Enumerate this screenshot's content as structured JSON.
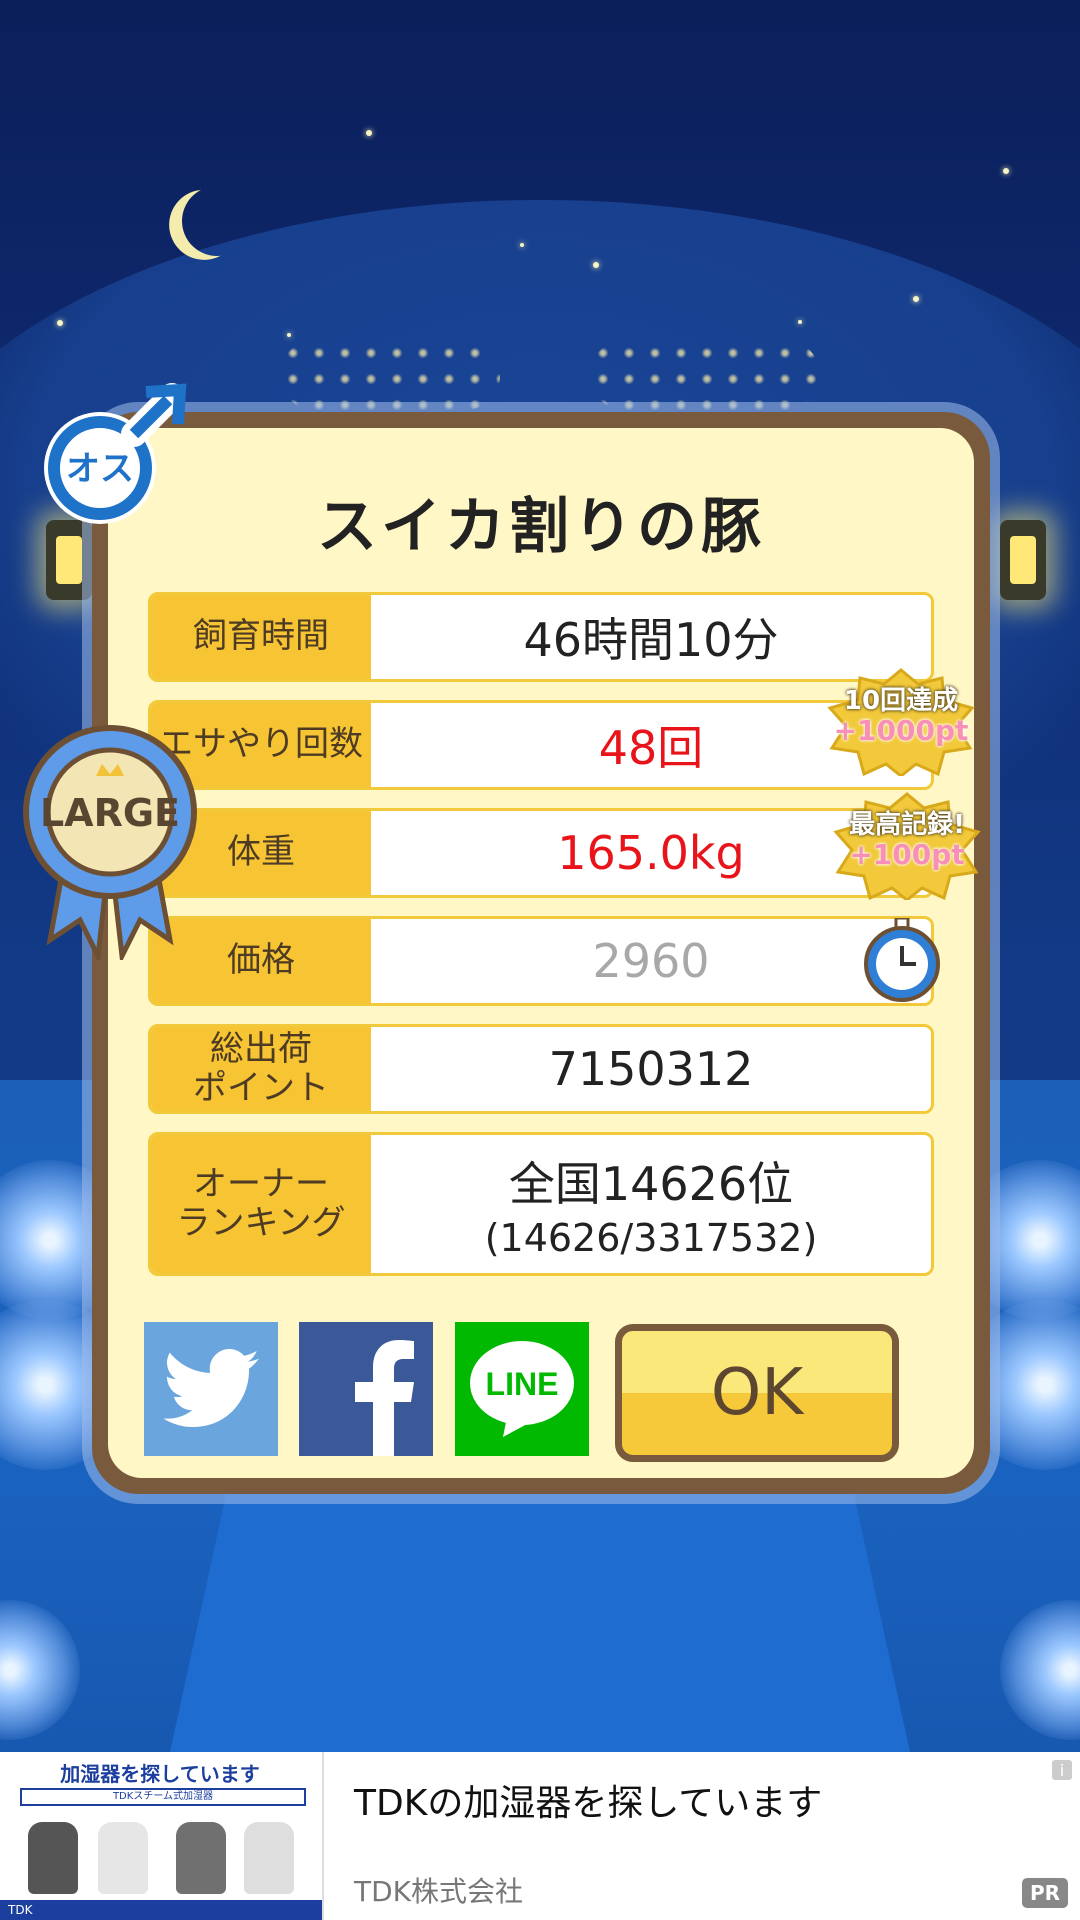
{
  "dialog": {
    "title": "スイカ割りの豚",
    "rows": [
      {
        "label": "飼育時間",
        "value": "46時間10分"
      },
      {
        "label": "エサやり回数",
        "value": "48回"
      },
      {
        "label": "体重",
        "value": "165.0kg"
      },
      {
        "label": "価格",
        "value": "2960"
      },
      {
        "label_line1": "総出荷",
        "label_line2": "ポイント",
        "value": "7150312"
      },
      {
        "label_line1": "オーナー",
        "label_line2": "ランキング",
        "value_main": "全国14626位",
        "value_sub": "(14626/3317532)"
      }
    ],
    "ok_label": "OK",
    "share": {
      "twitter": "twitter-share",
      "facebook": "facebook-share",
      "line_label": "LINE"
    }
  },
  "gender_badge": {
    "text": "オス",
    "icon": "male-symbol-icon"
  },
  "size_ribbon": {
    "text": "LARGE",
    "icon": "ribbon-icon"
  },
  "bonus_badges": [
    {
      "top": "10回達成",
      "bottom": "+1000pt"
    },
    {
      "top": "最高記録!",
      "bottom": "+100pt"
    }
  ],
  "timer_icon": "clock-icon",
  "ad": {
    "image_heading": "加湿器を探しています",
    "image_strip": "TDKスチーム式加湿器",
    "image_footer": "TDK",
    "title": "TDKの加湿器を探しています",
    "advertiser": "TDK株式会社",
    "pr_label": "PR",
    "info_icon": "i"
  },
  "colors": {
    "label_bg": "#f7c433",
    "dialog_bg": "#fff8c6",
    "frame": "#7a5a3c",
    "value_red": "#e8141a",
    "value_gray": "#a8a8a8"
  }
}
